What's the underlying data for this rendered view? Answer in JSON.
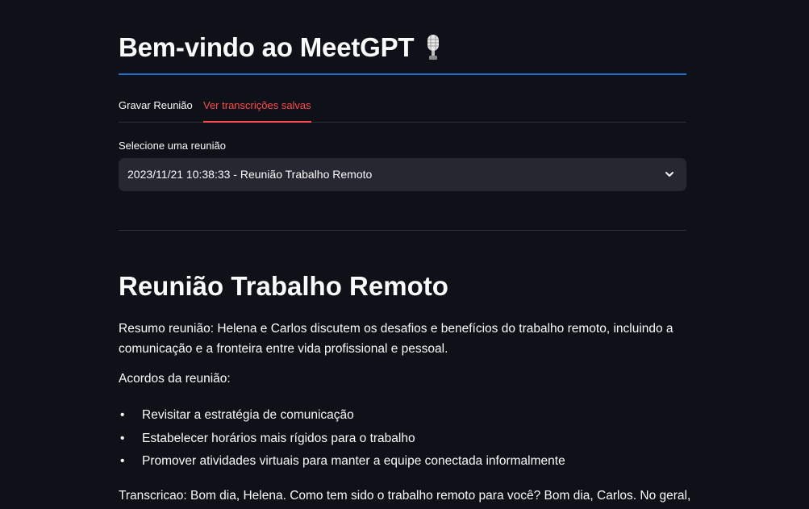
{
  "header": {
    "title": "Bem-vindo ao MeetGPT",
    "title_icon": "microphone-icon"
  },
  "tabs": [
    {
      "label": "Gravar Reunião",
      "active": false
    },
    {
      "label": "Ver transcrições salvas",
      "active": true
    }
  ],
  "colors": {
    "background": "#0e1117",
    "accent": "#ff4b4b",
    "title_rule": "#1f6fd1",
    "select_bg": "#262730"
  },
  "meeting_select": {
    "label": "Selecione uma reunião",
    "selected": "2023/11/21 10:38:33 - Reunião Trabalho Remoto"
  },
  "meeting": {
    "title": "Reunião Trabalho Remoto",
    "summary": "Resumo reunião: Helena e Carlos discutem os desafios e benefícios do trabalho remoto, incluindo a comunicação e a fronteira entre vida profissional e pessoal.",
    "agreements_label": "Acordos da reunião:",
    "agreements": [
      "Revisitar a estratégia de comunicação",
      "Estabelecer horários mais rígidos para o trabalho",
      "Promover atividades virtuais para manter a equipe conectada informalmente"
    ],
    "transcript": "Transcricao: Bom dia, Helena. Como tem sido o trabalho remoto para você? Bom dia, Carlos. No geral,"
  }
}
